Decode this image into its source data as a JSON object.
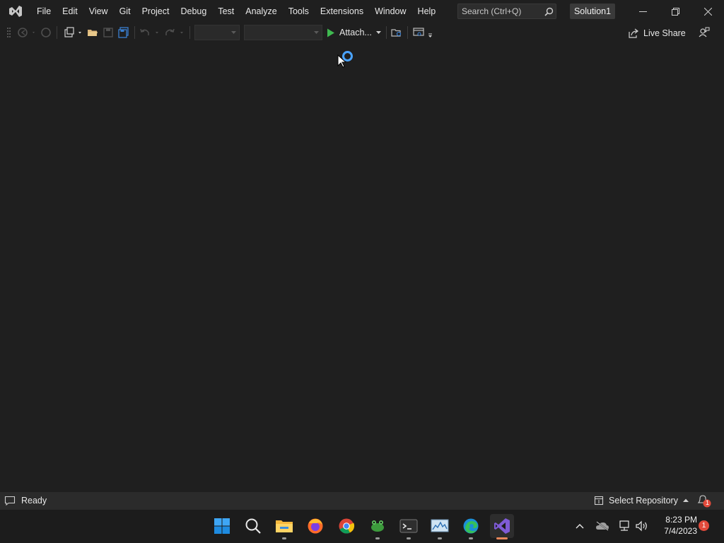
{
  "menu": {
    "items": [
      "File",
      "Edit",
      "View",
      "Git",
      "Project",
      "Debug",
      "Test",
      "Analyze",
      "Tools",
      "Extensions",
      "Window",
      "Help"
    ]
  },
  "search": {
    "placeholder": "Search (Ctrl+Q)"
  },
  "solution": {
    "name": "Solution1"
  },
  "toolbar": {
    "attach_label": "Attach...",
    "live_share_label": "Live Share"
  },
  "status": {
    "ready": "Ready",
    "select_repository": "Select Repository",
    "notifications_count": "1"
  },
  "clock": {
    "time": "8:23 PM",
    "date": "7/4/2023"
  },
  "tray": {
    "notification_count": "1"
  },
  "colors": {
    "background": "#1f1f1f",
    "statusbar": "#2b2b2b",
    "accent_purple": "#7f5bd6",
    "spinner_blue": "#4aa3ff",
    "badge_red": "#e24a3b"
  }
}
